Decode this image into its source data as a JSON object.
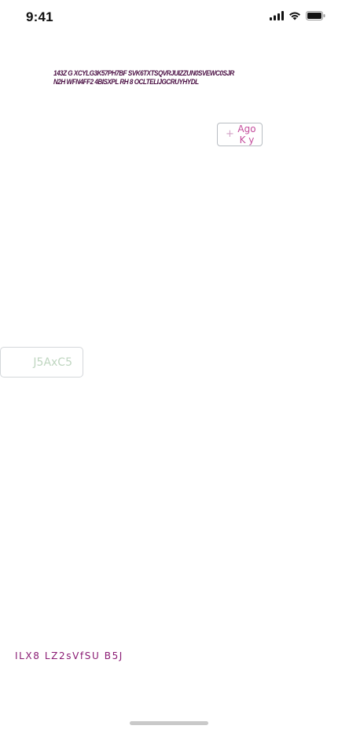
{
  "status_bar": {
    "time": "9:41",
    "icons": [
      "signal-icon",
      "wifi-icon",
      "battery-icon"
    ]
  },
  "headline": {
    "text": "143Z G XCYLG3K57PH7BF SVK6TXTSQVRJUIZZUN0SVEWC0SJRN2H WFN4FF2 4BISXPL RH 8 OCLTELIJGCRUYHYDL"
  },
  "add_button": {
    "icon": "plus-icon",
    "label": "AgoK y"
  },
  "faded_box": {
    "label": "J5AxC5"
  },
  "footer": {
    "text": "ILX8 LZ2sVfSU B5J"
  },
  "colors": {
    "headline": "#4a0f43",
    "add_label": "#c44d9c",
    "faded_label": "#bfd6c0",
    "footer": "#8a1b73"
  }
}
